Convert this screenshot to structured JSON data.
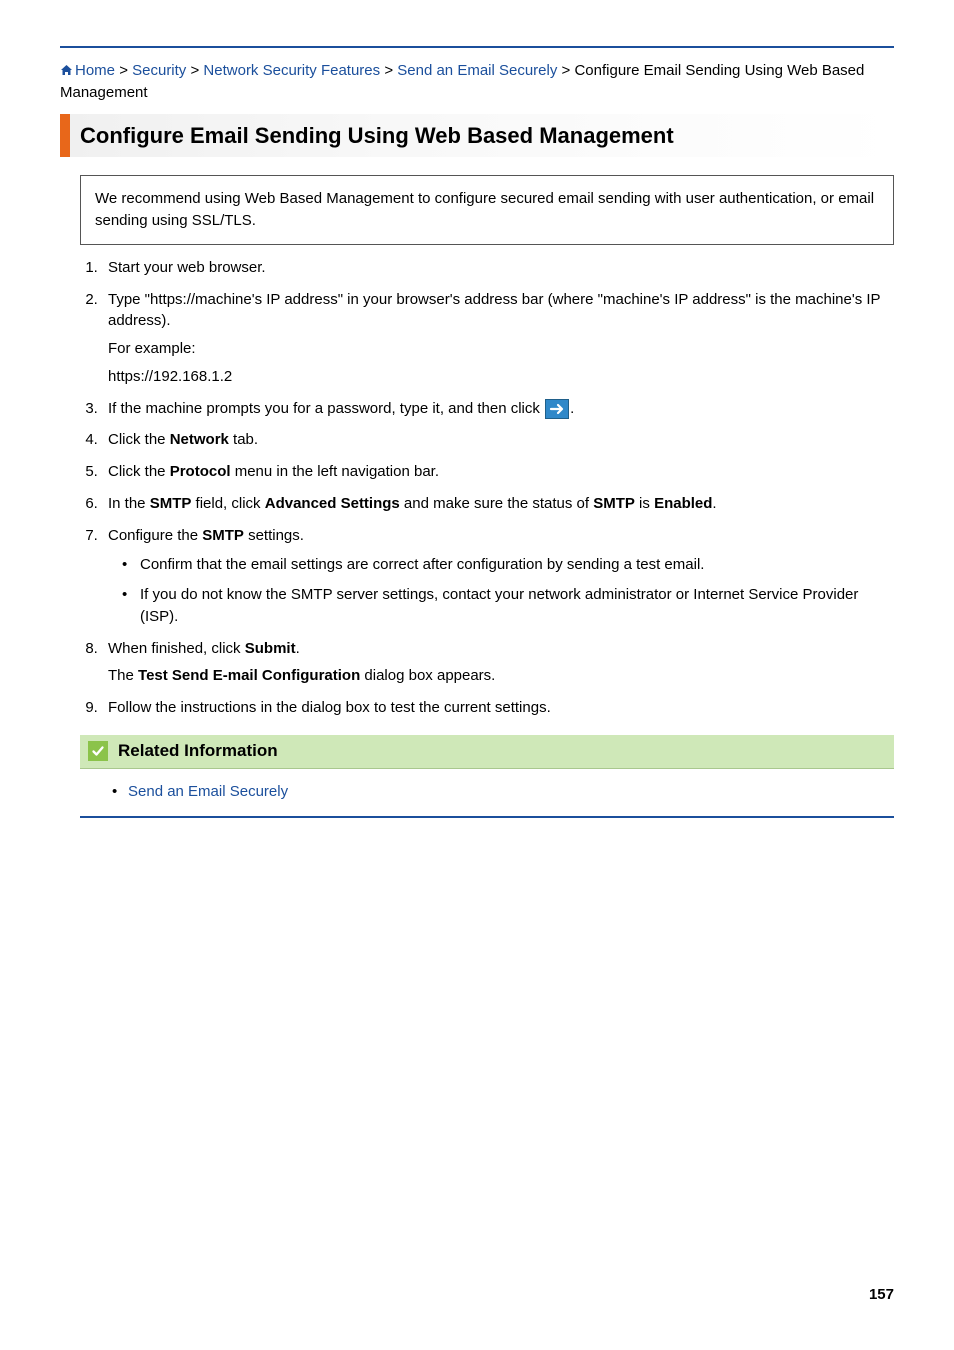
{
  "breadcrumb": {
    "home": "Home",
    "sep": ">",
    "link1": "Security",
    "link2": "Network Security Features",
    "link3": "Send an Email Securely",
    "current": "Configure Email Sending Using Web Based Management"
  },
  "heading": "Configure Email Sending Using Web Based Management",
  "intro": "We recommend using Web Based Management to configure secured email sending with user authentication, or email sending using SSL/TLS.",
  "steps": {
    "s1": "Start your web browser.",
    "s2_a": "Type \"https://machine's IP address\" in your browser's address bar (where \"machine's IP address\" is the machine's IP address).",
    "s2_b": "For example:",
    "s2_c": "https://192.168.1.2",
    "s3_a": "If the machine prompts you for a password, type it, and then click ",
    "s3_b": ".",
    "s4_a": "Click the ",
    "s4_b": "Network",
    "s4_c": " tab.",
    "s5_a": "Click the ",
    "s5_b": "Protocol",
    "s5_c": " menu in the left navigation bar.",
    "s6_a": "In the ",
    "s6_b": "SMTP",
    "s6_c": " field, click ",
    "s6_d": "Advanced Settings",
    "s6_e": " and make sure the status of ",
    "s6_f": "SMTP",
    "s6_g": " is ",
    "s6_h": "Enabled",
    "s6_i": ".",
    "s7_a": "Configure the ",
    "s7_b": "SMTP",
    "s7_c": " settings.",
    "s7_bullet1": "Confirm that the email settings are correct after configuration by sending a test email.",
    "s7_bullet2": "If you do not know the SMTP server settings, contact your network administrator or Internet Service Provider (ISP).",
    "s8_a": "When finished, click ",
    "s8_b": "Submit",
    "s8_c": ".",
    "s8_d_a": "The ",
    "s8_d_b": "Test Send E-mail Configuration",
    "s8_d_c": " dialog box appears.",
    "s9": "Follow the instructions in the dialog box to test the current settings."
  },
  "related": {
    "title": "Related Information",
    "link1": "Send an Email Securely"
  },
  "page_number": "157"
}
